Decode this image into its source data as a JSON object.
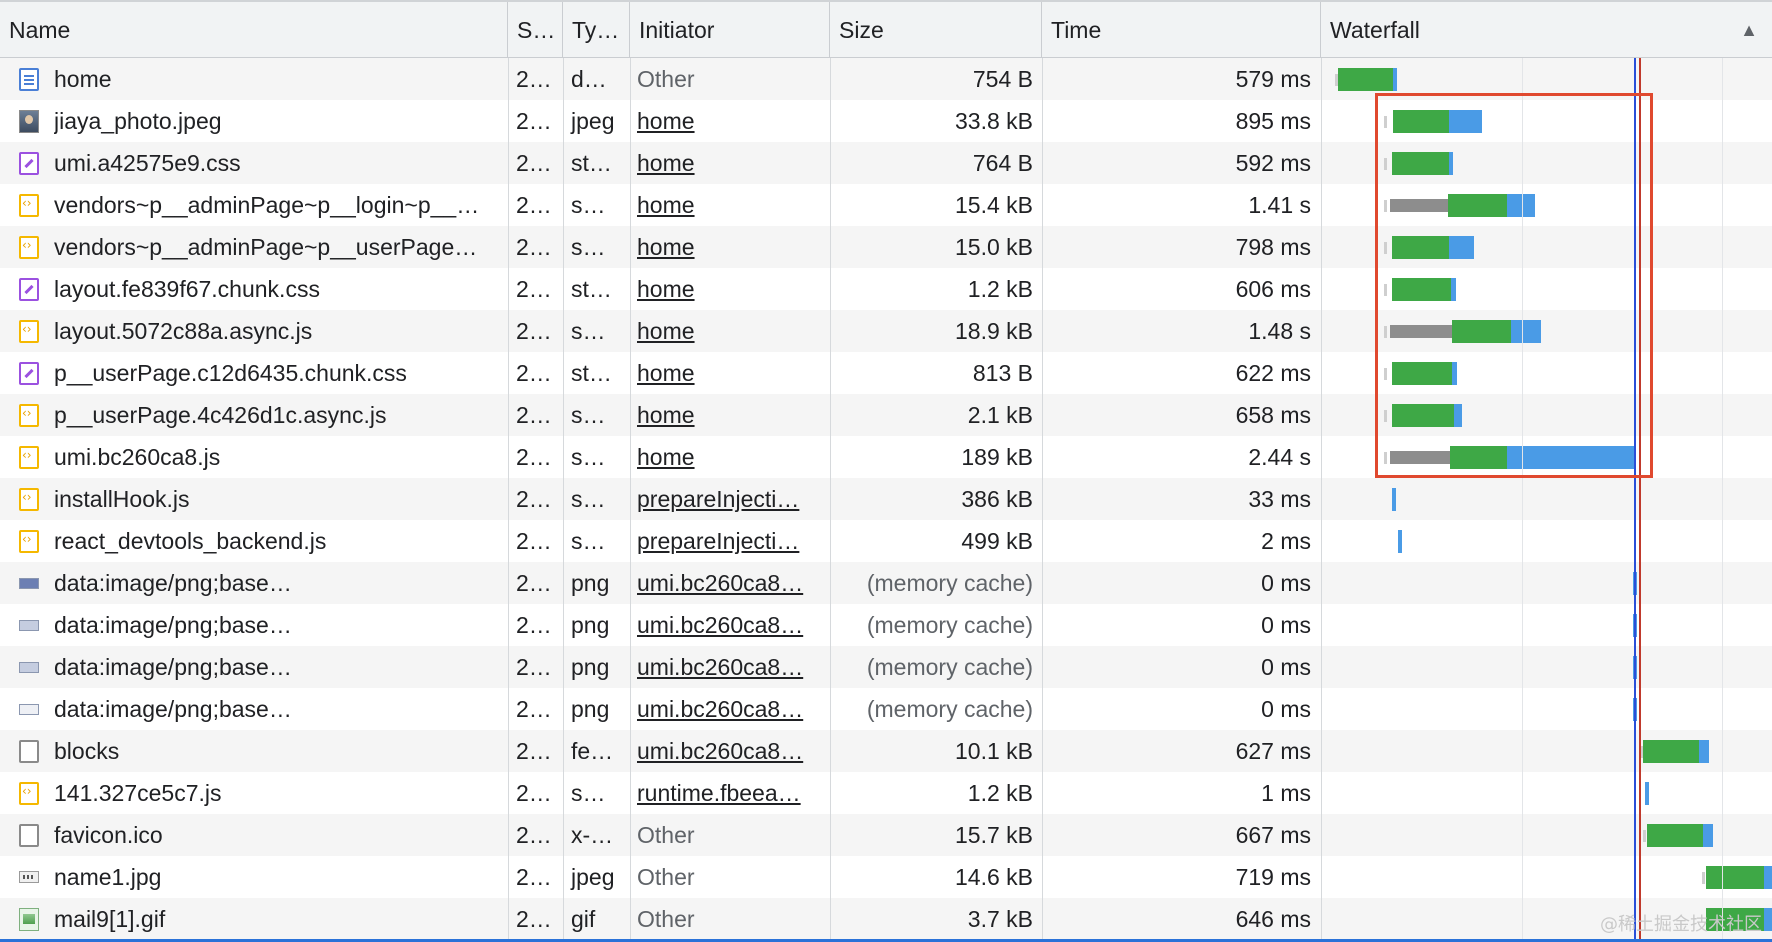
{
  "columns": {
    "name": "Name",
    "status": "S…",
    "type": "Ty…",
    "initiator": "Initiator",
    "size": "Size",
    "time": "Time",
    "waterfall": "Waterfall",
    "sort_indicator": "▲"
  },
  "requests": [
    {
      "icon": "document-icon",
      "name": "home",
      "status": "2…",
      "type": "d…",
      "initiator": "Other",
      "initiator_link": false,
      "size": "754 B",
      "time": "579 ms"
    },
    {
      "icon": "image-thumbnail-icon",
      "name": "jiaya_photo.jpeg",
      "status": "2…",
      "type": "jpeg",
      "initiator": "home",
      "initiator_link": true,
      "size": "33.8 kB",
      "time": "895 ms"
    },
    {
      "icon": "stylesheet-icon",
      "name": "umi.a42575e9.css",
      "status": "2…",
      "type": "st…",
      "initiator": "home",
      "initiator_link": true,
      "size": "764 B",
      "time": "592 ms"
    },
    {
      "icon": "script-icon",
      "name": "vendors~p__adminPage~p__login~p__…",
      "status": "2…",
      "type": "s…",
      "initiator": "home",
      "initiator_link": true,
      "size": "15.4 kB",
      "time": "1.41 s"
    },
    {
      "icon": "script-icon",
      "name": "vendors~p__adminPage~p__userPage…",
      "status": "2…",
      "type": "s…",
      "initiator": "home",
      "initiator_link": true,
      "size": "15.0 kB",
      "time": "798 ms"
    },
    {
      "icon": "stylesheet-icon",
      "name": "layout.fe839f67.chunk.css",
      "status": "2…",
      "type": "st…",
      "initiator": "home",
      "initiator_link": true,
      "size": "1.2 kB",
      "time": "606 ms"
    },
    {
      "icon": "script-icon",
      "name": "layout.5072c88a.async.js",
      "status": "2…",
      "type": "s…",
      "initiator": "home",
      "initiator_link": true,
      "size": "18.9 kB",
      "time": "1.48 s"
    },
    {
      "icon": "stylesheet-icon",
      "name": "p__userPage.c12d6435.chunk.css",
      "status": "2…",
      "type": "st…",
      "initiator": "home",
      "initiator_link": true,
      "size": "813 B",
      "time": "622 ms"
    },
    {
      "icon": "script-icon",
      "name": "p__userPage.4c426d1c.async.js",
      "status": "2…",
      "type": "s…",
      "initiator": "home",
      "initiator_link": true,
      "size": "2.1 kB",
      "time": "658 ms"
    },
    {
      "icon": "script-icon",
      "name": "umi.bc260ca8.js",
      "status": "2…",
      "type": "s…",
      "initiator": "home",
      "initiator_link": true,
      "size": "189 kB",
      "time": "2.44 s"
    },
    {
      "icon": "script-icon",
      "name": "installHook.js",
      "status": "2…",
      "type": "s…",
      "initiator": "prepareInjecti…",
      "initiator_link": true,
      "size": "386 kB",
      "time": "33 ms"
    },
    {
      "icon": "script-icon",
      "name": "react_devtools_backend.js",
      "status": "2…",
      "type": "s…",
      "initiator": "prepareInjecti…",
      "initiator_link": true,
      "size": "499 kB",
      "time": "2 ms"
    },
    {
      "icon": "png-data-icon",
      "name": "data:image/png;base…",
      "status": "2…",
      "type": "png",
      "initiator": "umi.bc260ca8…",
      "initiator_link": true,
      "size": "(memory cache)",
      "time": "0 ms"
    },
    {
      "icon": "png-data-icon",
      "name": "data:image/png;base…",
      "status": "2…",
      "type": "png",
      "initiator": "umi.bc260ca8…",
      "initiator_link": true,
      "size": "(memory cache)",
      "time": "0 ms"
    },
    {
      "icon": "png-data-icon",
      "name": "data:image/png;base…",
      "status": "2…",
      "type": "png",
      "initiator": "umi.bc260ca8…",
      "initiator_link": true,
      "size": "(memory cache)",
      "time": "0 ms"
    },
    {
      "icon": "png-data-icon",
      "name": "data:image/png;base…",
      "status": "2…",
      "type": "png",
      "initiator": "umi.bc260ca8…",
      "initiator_link": true,
      "size": "(memory cache)",
      "time": "0 ms"
    },
    {
      "icon": "blank-file-icon",
      "name": "blocks",
      "status": "2…",
      "type": "fe…",
      "initiator": "umi.bc260ca8…",
      "initiator_link": true,
      "size": "10.1 kB",
      "time": "627 ms"
    },
    {
      "icon": "script-icon",
      "name": "141.327ce5c7.js",
      "status": "2…",
      "type": "s…",
      "initiator": "runtime.fbeea…",
      "initiator_link": true,
      "size": "1.2 kB",
      "time": "1 ms"
    },
    {
      "icon": "blank-file-icon",
      "name": "favicon.ico",
      "status": "2…",
      "type": "x-…",
      "initiator": "Other",
      "initiator_link": false,
      "size": "15.7 kB",
      "time": "667 ms"
    },
    {
      "icon": "jpg-icon",
      "name": "name1.jpg",
      "status": "2…",
      "type": "jpeg",
      "initiator": "Other",
      "initiator_link": false,
      "size": "14.6 kB",
      "time": "719 ms"
    },
    {
      "icon": "gif-icon",
      "name": "mail9[1].gif",
      "status": "2…",
      "type": "gif",
      "initiator": "Other",
      "initiator_link": false,
      "size": "3.7 kB",
      "time": "646 ms"
    }
  ],
  "watermark": "@稀土掘金技术社区",
  "colors": {
    "waiting": "#8d8d8d",
    "ttfb": "#3ea846",
    "download": "#4a9be6",
    "highlight": "#e0492f",
    "dom_content_loaded": "#2a4fd8",
    "load_event": "#c0392b"
  }
}
